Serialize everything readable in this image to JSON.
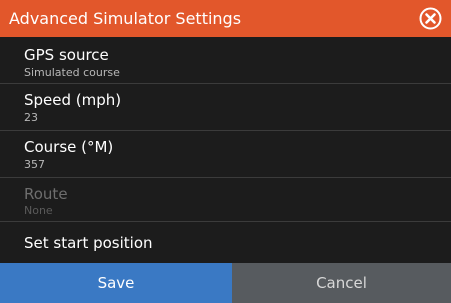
{
  "dialog": {
    "title": "Advanced Simulator Settings",
    "close_icon": "close-circle-icon",
    "accent_color": "#e2572b"
  },
  "settings": [
    {
      "label": "GPS source",
      "value": "Simulated course",
      "enabled": true
    },
    {
      "label": "Speed (mph)",
      "value": "23",
      "enabled": true
    },
    {
      "label": "Course (°M)",
      "value": "357",
      "enabled": true
    },
    {
      "label": "Route",
      "value": "None",
      "enabled": false
    },
    {
      "label": "Set start position",
      "enabled": true
    }
  ],
  "footer": {
    "save_label": "Save",
    "cancel_label": "Cancel",
    "save_color": "#3a79c4",
    "cancel_color": "#575b5f"
  }
}
